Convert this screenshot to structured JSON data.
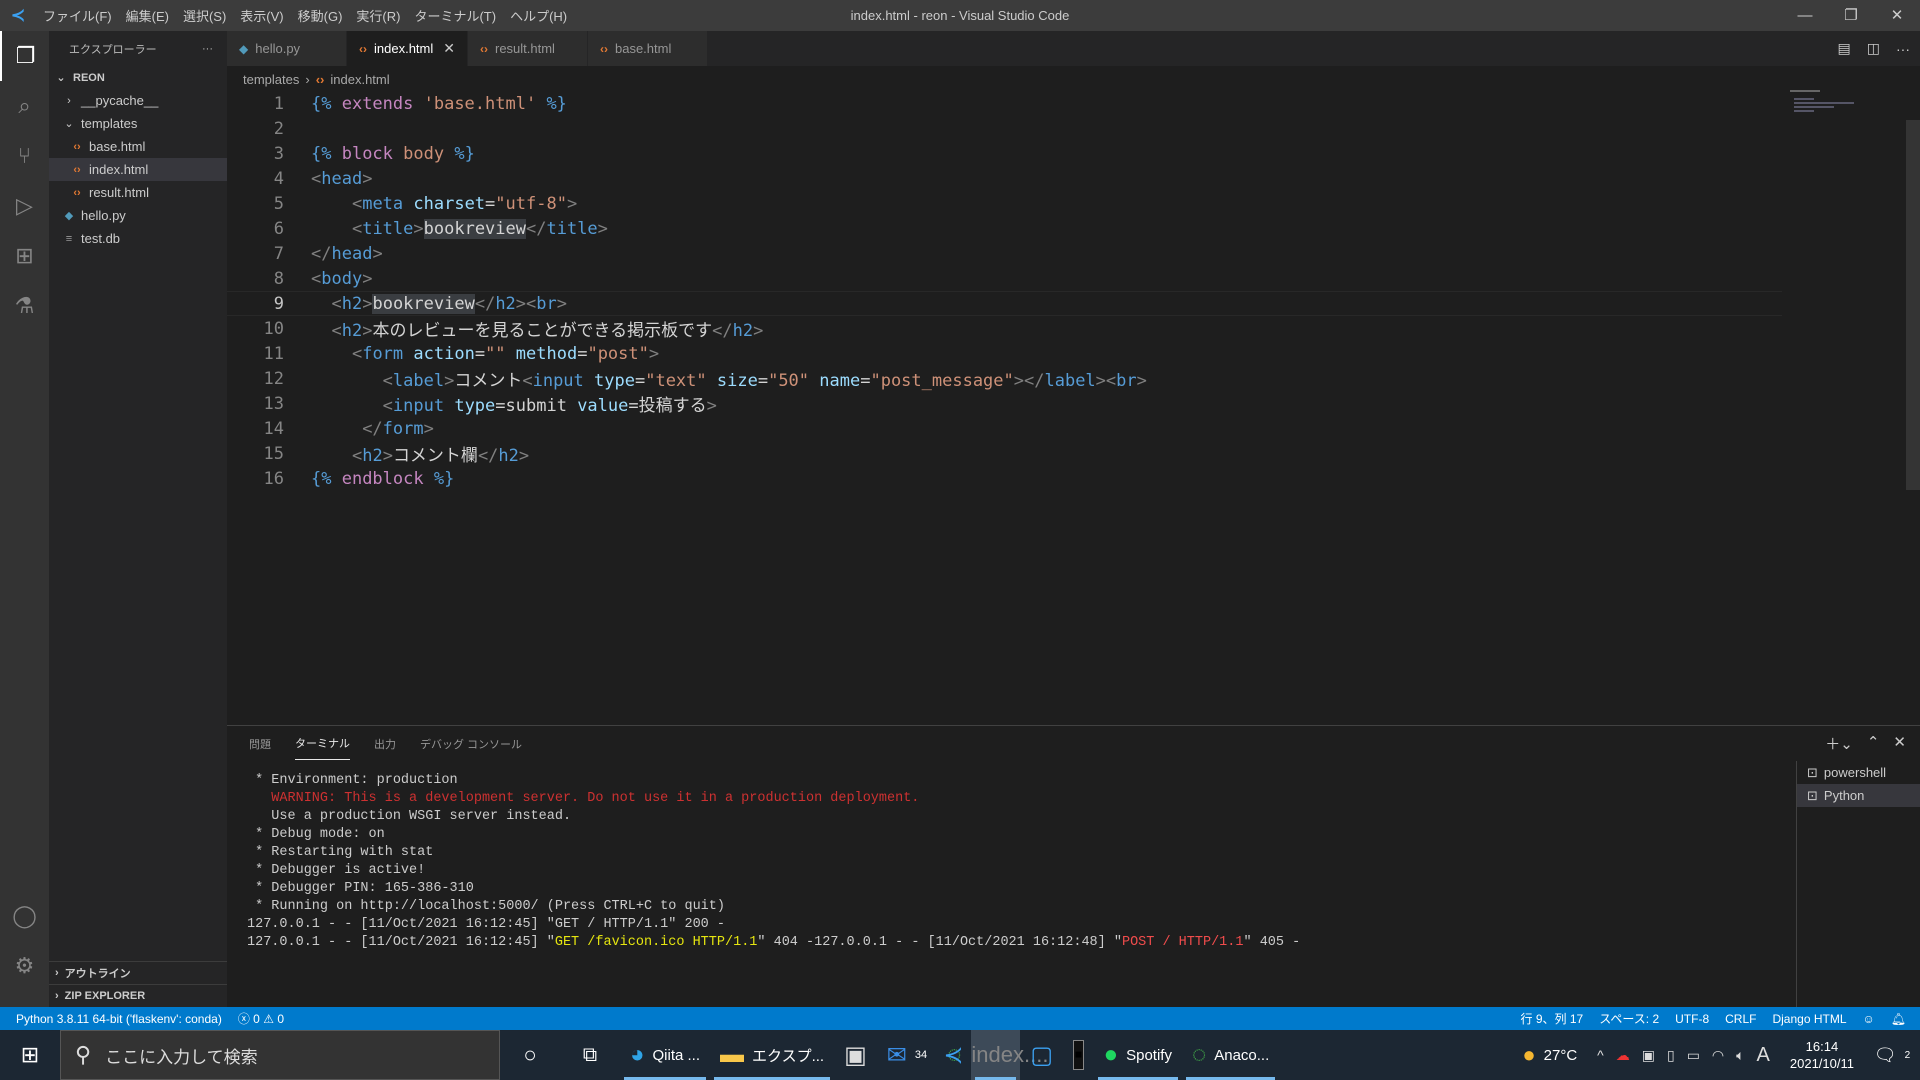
{
  "titlebar": {
    "title": "index.html - reon - Visual Studio Code",
    "menus": [
      "ファイル(F)",
      "編集(E)",
      "選択(S)",
      "表示(V)",
      "移動(G)",
      "実行(R)",
      "ターミナル(T)",
      "ヘルプ(H)"
    ]
  },
  "sidebar": {
    "title": "エクスプローラー",
    "more": "···",
    "root": "REON",
    "items": [
      {
        "label": "__pycache__",
        "type": "folder-collapsed",
        "depth": 1
      },
      {
        "label": "templates",
        "type": "folder-open",
        "depth": 1
      },
      {
        "label": "base.html",
        "type": "html",
        "depth": 2
      },
      {
        "label": "index.html",
        "type": "html",
        "depth": 2,
        "selected": true
      },
      {
        "label": "result.html",
        "type": "html",
        "depth": 2
      },
      {
        "label": "hello.py",
        "type": "python",
        "depth": 1
      },
      {
        "label": "test.db",
        "type": "db",
        "depth": 1
      }
    ],
    "outline": "アウトライン",
    "zip": "ZIP EXPLORER"
  },
  "tabs": [
    {
      "label": "hello.py",
      "icon": "python"
    },
    {
      "label": "index.html",
      "icon": "html",
      "active": true
    },
    {
      "label": "result.html",
      "icon": "html"
    },
    {
      "label": "base.html",
      "icon": "html"
    }
  ],
  "breadcrumb": [
    "templates",
    "index.html"
  ],
  "editor": {
    "current_line": 9,
    "lines": [
      [
        [
          "{%",
          "jj"
        ],
        [
          " extends ",
          "kw"
        ],
        [
          "'base.html'",
          "str"
        ],
        [
          " %}",
          "jj"
        ]
      ],
      [],
      [
        [
          "{%",
          "jj"
        ],
        [
          " block ",
          "kw"
        ],
        [
          "body",
          "str"
        ],
        [
          " %}",
          "jj"
        ]
      ],
      [
        [
          "<",
          "br"
        ],
        [
          "head",
          "tag"
        ],
        [
          ">",
          "br"
        ]
      ],
      [
        [
          "    <",
          "br"
        ],
        [
          "meta",
          "tag"
        ],
        [
          " charset",
          "attr"
        ],
        [
          "=",
          "op"
        ],
        [
          "\"utf-8\"",
          "str"
        ],
        [
          ">",
          "br"
        ]
      ],
      [
        [
          "    <",
          "br"
        ],
        [
          "title",
          "tag"
        ],
        [
          ">",
          "br"
        ],
        [
          "bookreview",
          "sel"
        ],
        [
          "</",
          "br"
        ],
        [
          "title",
          "tag"
        ],
        [
          ">",
          "br"
        ]
      ],
      [
        [
          "</",
          "br"
        ],
        [
          "head",
          "tag"
        ],
        [
          ">",
          "br"
        ]
      ],
      [
        [
          "<",
          "br"
        ],
        [
          "body",
          "tag"
        ],
        [
          ">",
          "br"
        ]
      ],
      [
        [
          "  <",
          "br"
        ],
        [
          "h2",
          "tag"
        ],
        [
          ">",
          "br"
        ],
        [
          "bookreview",
          "sel"
        ],
        [
          "</",
          "br"
        ],
        [
          "h2",
          "tag"
        ],
        [
          ">",
          "br"
        ],
        [
          "<",
          "br"
        ],
        [
          "br",
          "tag"
        ],
        [
          ">",
          "br"
        ]
      ],
      [
        [
          "  <",
          "br"
        ],
        [
          "h2",
          "tag"
        ],
        [
          ">",
          "br"
        ],
        [
          "本のレビューを見ることができる掲示板です",
          "txt"
        ],
        [
          "</",
          "br"
        ],
        [
          "h2",
          "tag"
        ],
        [
          ">",
          "br"
        ]
      ],
      [
        [
          "    <",
          "br"
        ],
        [
          "form",
          "tag"
        ],
        [
          " action",
          "attr"
        ],
        [
          "=",
          "op"
        ],
        [
          "\"\"",
          "str"
        ],
        [
          " method",
          "attr"
        ],
        [
          "=",
          "op"
        ],
        [
          "\"post\"",
          "str"
        ],
        [
          ">",
          "br"
        ]
      ],
      [
        [
          "       <",
          "br"
        ],
        [
          "label",
          "tag"
        ],
        [
          ">",
          "br"
        ],
        [
          "コメント",
          "txt"
        ],
        [
          "<",
          "br"
        ],
        [
          "input",
          "tag"
        ],
        [
          " type",
          "attr"
        ],
        [
          "=",
          "op"
        ],
        [
          "\"text\"",
          "str"
        ],
        [
          " size",
          "attr"
        ],
        [
          "=",
          "op"
        ],
        [
          "\"50\"",
          "str"
        ],
        [
          " name",
          "attr"
        ],
        [
          "=",
          "op"
        ],
        [
          "\"post_message\"",
          "str"
        ],
        [
          "></",
          "br"
        ],
        [
          "label",
          "tag"
        ],
        [
          "><",
          "br"
        ],
        [
          "br",
          "tag"
        ],
        [
          ">",
          "br"
        ]
      ],
      [
        [
          "       <",
          "br"
        ],
        [
          "input",
          "tag"
        ],
        [
          " type",
          "attr"
        ],
        [
          "=",
          "op"
        ],
        [
          "submit",
          "txt"
        ],
        [
          " value",
          "attr"
        ],
        [
          "=",
          "op"
        ],
        [
          "投稿する",
          "txt"
        ],
        [
          ">",
          "br"
        ]
      ],
      [
        [
          "     </",
          "br"
        ],
        [
          "form",
          "tag"
        ],
        [
          ">",
          "br"
        ]
      ],
      [
        [
          "    <",
          "br"
        ],
        [
          "h2",
          "tag"
        ],
        [
          ">",
          "br"
        ],
        [
          "コメント欄",
          "txt"
        ],
        [
          "</",
          "br"
        ],
        [
          "h2",
          "tag"
        ],
        [
          ">",
          "br"
        ]
      ],
      [
        [
          "{%",
          "jj"
        ],
        [
          " endblock ",
          "kw"
        ],
        [
          "%}",
          "jj"
        ]
      ]
    ]
  },
  "panel": {
    "tabs": [
      "問題",
      "ターミナル",
      "出力",
      "デバッグ コンソール"
    ],
    "active_tab": "ターミナル",
    "terminal": [
      [
        [
          " * Environment: production",
          ""
        ]
      ],
      [
        [
          "   WARNING: This is a development server. Do not use it in a production deployment.",
          "tr"
        ]
      ],
      [
        [
          "   Use a production WSGI server instead.",
          ""
        ]
      ],
      [
        [
          " * Debug mode: on",
          ""
        ]
      ],
      [
        [
          " * Restarting with stat",
          ""
        ]
      ],
      [
        [
          " * Debugger is active!",
          ""
        ]
      ],
      [
        [
          " * Debugger PIN: 165-386-310",
          ""
        ]
      ],
      [
        [
          " * Running on http://localhost:5000/ (Press CTRL+C to quit)",
          ""
        ]
      ],
      [
        [
          "127.0.0.1 - - [11/Oct/2021 16:12:45] \"GET / HTTP/1.1\" 200 -",
          ""
        ]
      ],
      [
        [
          "127.0.0.1 - - [11/Oct/2021 16:12:45] \"",
          ""
        ],
        [
          "GET /favicon.ico HTTP/1.1",
          "ty"
        ],
        [
          "\" 404 -127.0.0.1 - - [11/Oct/2021 16:12:48] \"",
          ""
        ],
        [
          "POST / HTTP/1.1",
          "tr2"
        ],
        [
          "\" 405 -",
          ""
        ]
      ]
    ],
    "shells": [
      {
        "label": "powershell"
      },
      {
        "label": "Python",
        "active": true
      }
    ]
  },
  "status": {
    "interpreter": "Python 3.8.11 64-bit ('flaskenv': conda)",
    "errors": "0",
    "warnings": "0",
    "position": "行 9、列 17",
    "spaces": "スペース: 2",
    "encoding": "UTF-8",
    "eol": "CRLF",
    "language": "Django HTML",
    "accent": "#007acc"
  },
  "taskbar": {
    "search_placeholder": "ここに入力して検索",
    "apps": [
      {
        "label": "Qiita ..."
      },
      {
        "label": "エクスプ..."
      },
      {
        "label": ""
      },
      {
        "label": "",
        "badge": "34"
      },
      {
        "label": ""
      },
      {
        "label": "index...."
      },
      {
        "label": ""
      },
      {
        "label": ""
      },
      {
        "label": "Spotify"
      },
      {
        "label": "Anaco..."
      }
    ],
    "weather": "27°C",
    "ime": "A",
    "time": "16:14",
    "date": "2021/10/11",
    "notifications": "2"
  }
}
